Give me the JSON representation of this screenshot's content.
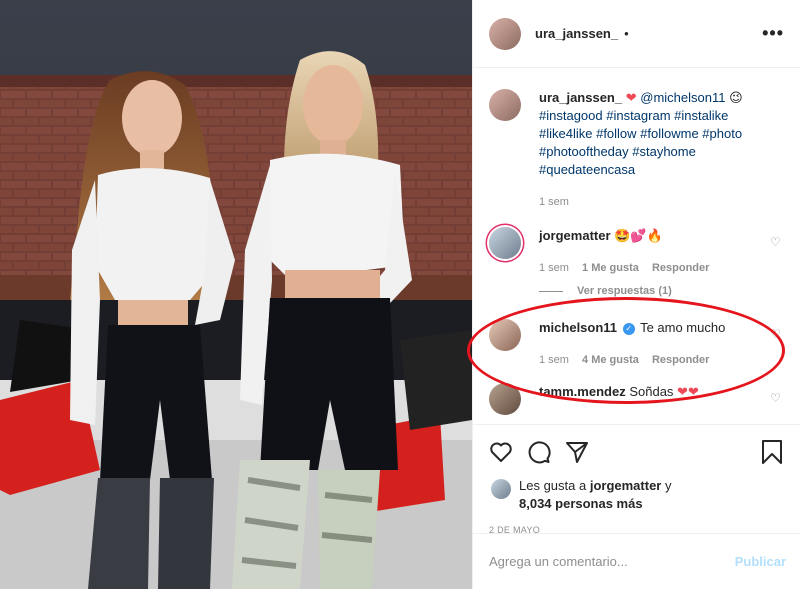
{
  "post": {
    "author": "ura_janssen_",
    "header_dot": "•",
    "more_icon": "more-dots-icon",
    "caption": {
      "author": "ura_janssen_",
      "heart": "❤",
      "mention": "@michelson11",
      "smile": "😉",
      "hashtags_line1": "#instagood #instagram #instalike",
      "hashtags_line2": "#like4like #follow #followme #photo",
      "hashtags_line3": "#photooftheday #stayhome",
      "hashtags_line4": "#quedateencasa",
      "time": "1 sem"
    }
  },
  "comments": [
    {
      "user": "jorgematter",
      "text": "🤩💕🔥",
      "time": "1 sem",
      "likes": "1 Me gusta",
      "reply": "Responder",
      "replies_label": "Ver respuestas (1)"
    },
    {
      "user": "michelson11",
      "verified": "✓",
      "text": "Te amo mucho",
      "time": "1 sem",
      "likes": "4 Me gusta",
      "reply": "Responder"
    },
    {
      "user": "tamm.mendez",
      "text": "Soñdas",
      "hearts": "❤❤"
    }
  ],
  "likes": {
    "prefix": "Les gusta a",
    "user": "jorgematter",
    "suffix": "y",
    "others": "8,034 personas más"
  },
  "date": "2 DE MAYO",
  "add_comment": {
    "placeholder": "Agrega un comentario...",
    "post_label": "Publicar"
  },
  "colors": {
    "link": "#00376b",
    "highlight_oval": "#e4151c",
    "post_disabled": "#b2dffc",
    "verified": "#3897f0"
  }
}
